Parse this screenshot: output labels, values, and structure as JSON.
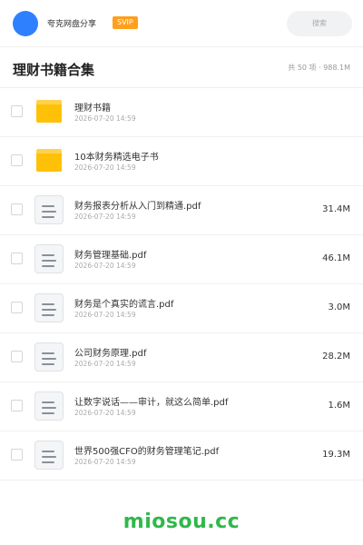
{
  "header": {
    "channel_name": "夸克网盘分享",
    "badge": "SVIP",
    "search_placeholder": "搜索"
  },
  "folder": {
    "title": "理财书籍合集",
    "summary": "共 50 项 · 988.1M"
  },
  "files": [
    {
      "type": "folder",
      "name": "理财书籍",
      "date": "2026-07-20 14:59",
      "size": ""
    },
    {
      "type": "folder",
      "name": "10本财务精选电子书",
      "date": "2026-07-20 14:59",
      "size": ""
    },
    {
      "type": "pdf",
      "name": "财务报表分析从入门到精通.pdf",
      "date": "2026-07-20 14:59",
      "size": "31.4M"
    },
    {
      "type": "pdf",
      "name": "财务管理基础.pdf",
      "date": "2026-07-20 14:59",
      "size": "46.1M"
    },
    {
      "type": "pdf",
      "name": "财务是个真实的谎言.pdf",
      "date": "2026-07-20 14:59",
      "size": "3.0M"
    },
    {
      "type": "pdf",
      "name": "公司财务原理.pdf",
      "date": "2026-07-20 14:59",
      "size": "28.2M"
    },
    {
      "type": "pdf",
      "name": "让数字说话——审计，就这么简单.pdf",
      "date": "2026-07-20 14:59",
      "size": "1.6M"
    },
    {
      "type": "pdf",
      "name": "世界500强CFO的财务管理笔记.pdf",
      "date": "2026-07-20 14:59",
      "size": "19.3M"
    }
  ],
  "footer": {
    "brand": "miosou.cc"
  },
  "colors": {
    "avatar": "#2f80ff",
    "badge": "#ff9f1c",
    "folder": "#ffc107",
    "brand": "#2fb84a"
  }
}
